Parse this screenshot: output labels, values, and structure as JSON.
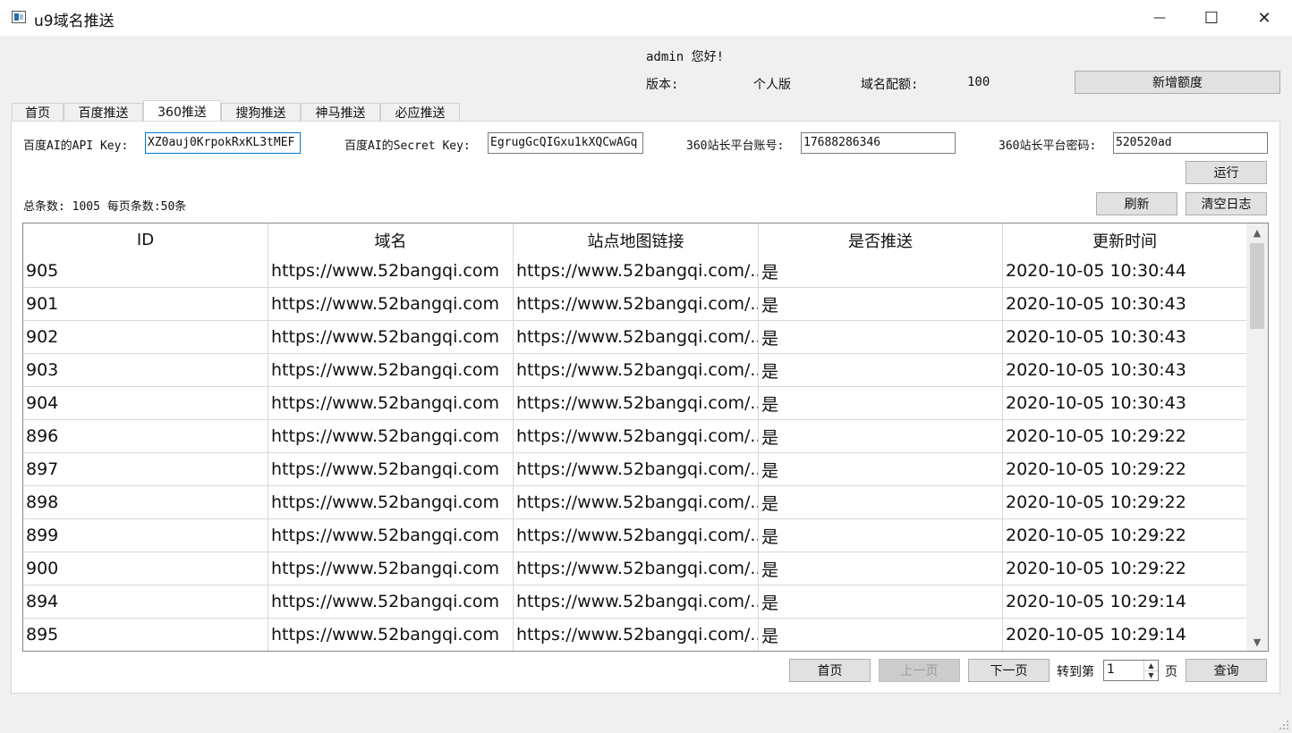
{
  "window": {
    "title": "u9域名推送",
    "minimize_glyph": "—",
    "maximize_glyph": "☐",
    "close_glyph": "✕"
  },
  "header": {
    "greeting": "admin 您好!",
    "version_label": "版本:",
    "version_value": "个人版",
    "quota_label": "域名配额:",
    "quota_value": "100",
    "add_quota_button": "新增额度"
  },
  "tabs": [
    {
      "label": "首页"
    },
    {
      "label": "百度推送"
    },
    {
      "label": "360推送",
      "active": true
    },
    {
      "label": "搜狗推送"
    },
    {
      "label": "神马推送"
    },
    {
      "label": "必应推送"
    }
  ],
  "form": {
    "api_key_label": "百度AI的API Key:",
    "api_key_value": "XZ0auj0KrpokRxKL3tMEF",
    "secret_key_label": "百度AI的Secret Key:",
    "secret_key_value": "EgrugGcQIGxu1kXQCwAGq",
    "account_label": "360站长平台账号:",
    "account_value": "17688286346",
    "password_label": "360站长平台密码:",
    "password_value": "520520ad",
    "run_button": "运行"
  },
  "summary": {
    "text": "总条数: 1005 每页条数:50条"
  },
  "actions": {
    "refresh": "刷新",
    "clear_log": "清空日志"
  },
  "table": {
    "columns": [
      "ID",
      "域名",
      "站点地图链接",
      "是否推送",
      "更新时间"
    ],
    "rows": [
      {
        "id": "905",
        "domain": "https://www.52bangqi.com",
        "sitemap": "https://www.52bangqi.com/...",
        "pushed": "是",
        "time": "2020-10-05 10:30:44"
      },
      {
        "id": "901",
        "domain": "https://www.52bangqi.com",
        "sitemap": "https://www.52bangqi.com/...",
        "pushed": "是",
        "time": "2020-10-05 10:30:43"
      },
      {
        "id": "902",
        "domain": "https://www.52bangqi.com",
        "sitemap": "https://www.52bangqi.com/...",
        "pushed": "是",
        "time": "2020-10-05 10:30:43"
      },
      {
        "id": "903",
        "domain": "https://www.52bangqi.com",
        "sitemap": "https://www.52bangqi.com/...",
        "pushed": "是",
        "time": "2020-10-05 10:30:43"
      },
      {
        "id": "904",
        "domain": "https://www.52bangqi.com",
        "sitemap": "https://www.52bangqi.com/...",
        "pushed": "是",
        "time": "2020-10-05 10:30:43"
      },
      {
        "id": "896",
        "domain": "https://www.52bangqi.com",
        "sitemap": "https://www.52bangqi.com/...",
        "pushed": "是",
        "time": "2020-10-05 10:29:22"
      },
      {
        "id": "897",
        "domain": "https://www.52bangqi.com",
        "sitemap": "https://www.52bangqi.com/...",
        "pushed": "是",
        "time": "2020-10-05 10:29:22"
      },
      {
        "id": "898",
        "domain": "https://www.52bangqi.com",
        "sitemap": "https://www.52bangqi.com/...",
        "pushed": "是",
        "time": "2020-10-05 10:29:22"
      },
      {
        "id": "899",
        "domain": "https://www.52bangqi.com",
        "sitemap": "https://www.52bangqi.com/...",
        "pushed": "是",
        "time": "2020-10-05 10:29:22"
      },
      {
        "id": "900",
        "domain": "https://www.52bangqi.com",
        "sitemap": "https://www.52bangqi.com/...",
        "pushed": "是",
        "time": "2020-10-05 10:29:22"
      },
      {
        "id": "894",
        "domain": "https://www.52bangqi.com",
        "sitemap": "https://www.52bangqi.com/...",
        "pushed": "是",
        "time": "2020-10-05 10:29:14"
      },
      {
        "id": "895",
        "domain": "https://www.52bangqi.com",
        "sitemap": "https://www.52bangqi.com/...",
        "pushed": "是",
        "time": "2020-10-05 10:29:14"
      }
    ]
  },
  "pagination": {
    "first": "首页",
    "prev": "上一页",
    "next": "下一页",
    "goto_label": "转到第",
    "page_value": "1",
    "page_suffix": "页",
    "query": "查询"
  }
}
